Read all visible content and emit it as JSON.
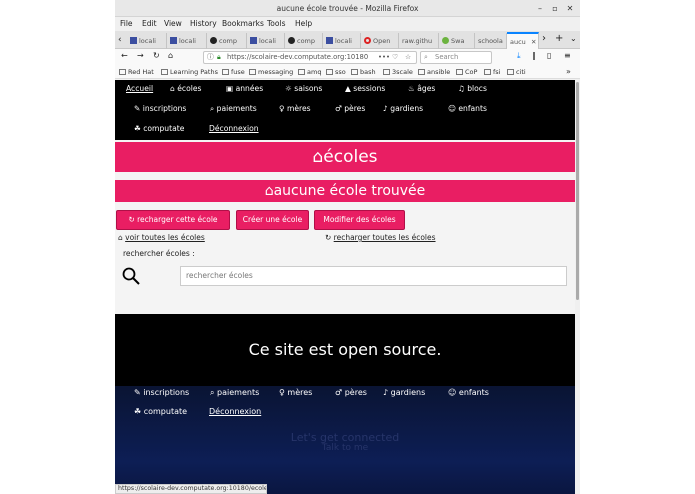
{
  "window": {
    "title": "aucune école trouvée - Mozilla Firefox"
  },
  "menu": [
    "File",
    "Edit",
    "View",
    "History",
    "Bookmarks",
    "Tools",
    "Help"
  ],
  "tabs": [
    {
      "label": "locali"
    },
    {
      "label": "locali"
    },
    {
      "label": "comp"
    },
    {
      "label": "locali"
    },
    {
      "label": "comp"
    },
    {
      "label": "locali"
    },
    {
      "label": "Open"
    },
    {
      "label": "raw.githu"
    },
    {
      "label": "Swa"
    },
    {
      "label": "schoola"
    },
    {
      "label": "aucu",
      "active": true
    }
  ],
  "urlbar": {
    "url": "https://scolaire-dev.computate.org:10180",
    "more": "•••"
  },
  "searchbar": {
    "placeholder": "Search"
  },
  "bookmarks": [
    "Red Hat",
    "Learning Paths",
    "fuse",
    "messaging",
    "amq",
    "sso",
    "bash",
    "3scale",
    "ansible",
    "CoP",
    "fsi",
    "citi"
  ],
  "nav": {
    "home": "Accueil",
    "ecoles": "écoles",
    "annees": "années",
    "saisons": "saisons",
    "sessions": "sessions",
    "ages": "âges",
    "blocs": "blocs",
    "inscriptions": "inscriptions",
    "paiements": "paiements",
    "meres": "mères",
    "peres": "pères",
    "gardiens": "gardiens",
    "enfants": "enfants",
    "computate": "computate",
    "logout": "Déconnexion"
  },
  "heading": "écoles",
  "subheading": "aucune école trouvée",
  "buttons": {
    "reload": "recharger cette école",
    "create": "Créer une école",
    "modify": "Modifier des écoles"
  },
  "links": {
    "viewAll": "voir toutes les écoles",
    "reloadAll": "recharger toutes les écoles"
  },
  "searchLabel": "rechercher écoles :",
  "searchPlaceholder": "rechercher écoles",
  "footer": {
    "opensource": "Ce site est open source.",
    "inscriptions": "inscriptions",
    "paiements": "paiements",
    "meres": "mères",
    "peres": "pères",
    "gardiens": "gardiens",
    "enfants": "enfants",
    "computate": "computate",
    "logout": "Déconnexion",
    "connect1": "Let's get connected",
    "connect2": "Talk to me"
  },
  "status": "https://scolaire-dev.computate.org:10180/ecole",
  "colors": {
    "accent": "#e91e63",
    "nav": "#000000",
    "footer": "#0d1e55"
  }
}
